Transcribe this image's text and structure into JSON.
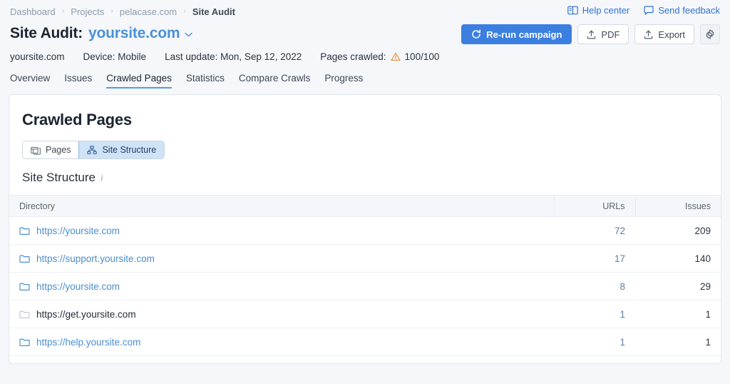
{
  "breadcrumb": {
    "items": [
      {
        "label": "Dashboard",
        "current": false
      },
      {
        "label": "Projects",
        "current": false
      },
      {
        "label": "pelacase.com",
        "current": false
      },
      {
        "label": "Site Audit",
        "current": true
      }
    ],
    "separator": "›"
  },
  "utility": {
    "help_center": "Help center",
    "send_feedback": "Send feedback",
    "help_icon": "book-icon",
    "feedback_icon": "speech-bubble-icon"
  },
  "header": {
    "title_prefix": "Site Audit:",
    "site_name": "yoursite.com",
    "caret_icon": "chevron-down-icon"
  },
  "actions": {
    "rerun_label": "Re-run campaign",
    "rerun_icon": "refresh-icon",
    "pdf_label": "PDF",
    "pdf_icon": "upload-icon",
    "export_label": "Export",
    "export_icon": "upload-icon",
    "settings_icon": "gear-icon",
    "primary_color": "#3b7fe0"
  },
  "meta": {
    "domain": "yoursite.com",
    "device": "Device: Mobile",
    "last_update": "Last update: Mon, Sep 12, 2022",
    "pages_crawled_label": "Pages crawled:",
    "pages_crawled_value": "100/100",
    "warning_icon": "warning-triangle-icon",
    "warning_color": "#e8964f"
  },
  "tabs": [
    {
      "label": "Overview",
      "active": false
    },
    {
      "label": "Issues",
      "active": false
    },
    {
      "label": "Crawled Pages",
      "active": true
    },
    {
      "label": "Statistics",
      "active": false
    },
    {
      "label": "Compare Crawls",
      "active": false
    },
    {
      "label": "Progress",
      "active": false
    }
  ],
  "card": {
    "title": "Crawled Pages",
    "segmented": [
      {
        "label": "Pages",
        "icon": "pages-icon",
        "active": false
      },
      {
        "label": "Site Structure",
        "icon": "sitemap-icon",
        "active": true
      }
    ],
    "section_title": "Site Structure",
    "info_icon": "info-icon"
  },
  "table": {
    "columns": [
      "Directory",
      "URLs",
      "Issues"
    ],
    "rows": [
      {
        "directory": "https://yoursite.com",
        "urls": "72",
        "issues": "209",
        "is_link": true
      },
      {
        "directory": "https://support.yoursite.com",
        "urls": "17",
        "issues": "140",
        "is_link": true
      },
      {
        "directory": "https://yoursite.com",
        "urls": "8",
        "issues": "29",
        "is_link": true
      },
      {
        "directory": "https://get.yoursite.com",
        "urls": "1",
        "issues": "1",
        "is_link": false
      },
      {
        "directory": "https://help.yoursite.com",
        "urls": "1",
        "issues": "1",
        "is_link": true
      }
    ]
  }
}
